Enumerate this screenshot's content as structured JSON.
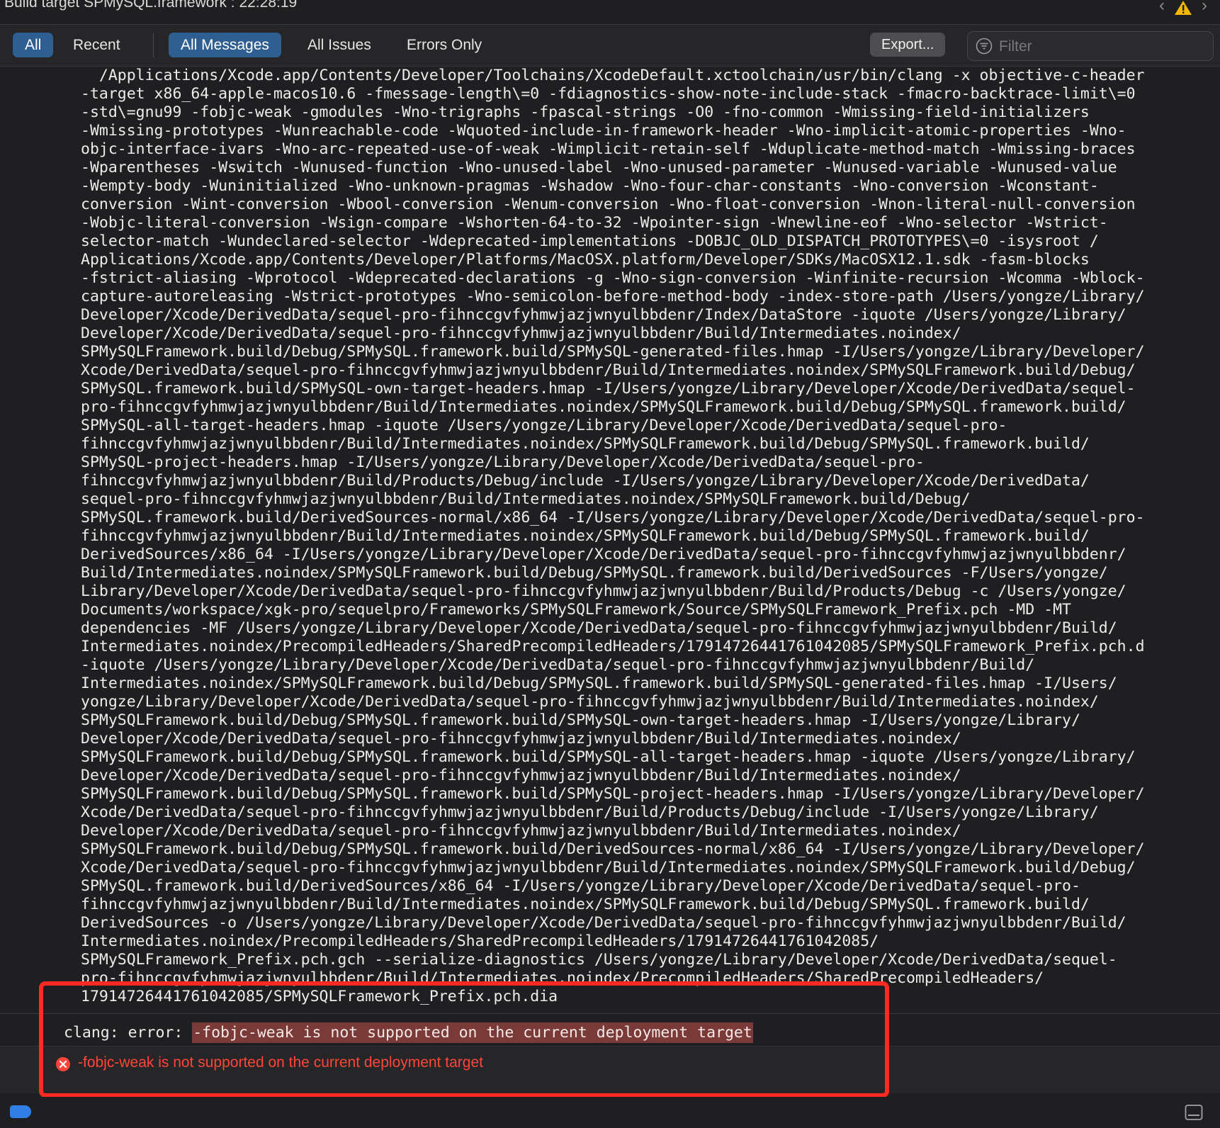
{
  "titlebar": {
    "title": "Build target SPMySQL.framework : 22:28:19"
  },
  "toolbar": {
    "scope_all": "All",
    "scope_recent": "Recent",
    "filter_all_messages": "All Messages",
    "filter_all_issues": "All Issues",
    "filter_errors_only": "Errors Only",
    "export_label": "Export...",
    "filter_placeholder": "Filter"
  },
  "log": {
    "lines": [
      "  /Applications/Xcode.app/Contents/Developer/Toolchains/XcodeDefault.xctoolchain/usr/bin/clang -x objective-c-header",
      "-target x86_64-apple-macos10.6 -fmessage-length\\=0 -fdiagnostics-show-note-include-stack -fmacro-backtrace-limit\\=0",
      "-std\\=gnu99 -fobjc-weak -gmodules -Wno-trigraphs -fpascal-strings -O0 -fno-common -Wmissing-field-initializers",
      "-Wmissing-prototypes -Wunreachable-code -Wquoted-include-in-framework-header -Wno-implicit-atomic-properties -Wno-",
      "objc-interface-ivars -Wno-arc-repeated-use-of-weak -Wimplicit-retain-self -Wduplicate-method-match -Wmissing-braces",
      "-Wparentheses -Wswitch -Wunused-function -Wno-unused-label -Wno-unused-parameter -Wunused-variable -Wunused-value",
      "-Wempty-body -Wuninitialized -Wno-unknown-pragmas -Wshadow -Wno-four-char-constants -Wno-conversion -Wconstant-",
      "conversion -Wint-conversion -Wbool-conversion -Wenum-conversion -Wno-float-conversion -Wnon-literal-null-conversion",
      "-Wobjc-literal-conversion -Wsign-compare -Wshorten-64-to-32 -Wpointer-sign -Wnewline-eof -Wno-selector -Wstrict-",
      "selector-match -Wundeclared-selector -Wdeprecated-implementations -DOBJC_OLD_DISPATCH_PROTOTYPES\\=0 -isysroot /",
      "Applications/Xcode.app/Contents/Developer/Platforms/MacOSX.platform/Developer/SDKs/MacOSX12.1.sdk -fasm-blocks",
      "-fstrict-aliasing -Wprotocol -Wdeprecated-declarations -g -Wno-sign-conversion -Winfinite-recursion -Wcomma -Wblock-",
      "capture-autoreleasing -Wstrict-prototypes -Wno-semicolon-before-method-body -index-store-path /Users/yongze/Library/",
      "Developer/Xcode/DerivedData/sequel-pro-fihnccgvfyhmwjazjwnyulbbdenr/Index/DataStore -iquote /Users/yongze/Library/",
      "Developer/Xcode/DerivedData/sequel-pro-fihnccgvfyhmwjazjwnyulbbdenr/Build/Intermediates.noindex/",
      "SPMySQLFramework.build/Debug/SPMySQL.framework.build/SPMySQL-generated-files.hmap -I/Users/yongze/Library/Developer/",
      "Xcode/DerivedData/sequel-pro-fihnccgvfyhmwjazjwnyulbbdenr/Build/Intermediates.noindex/SPMySQLFramework.build/Debug/",
      "SPMySQL.framework.build/SPMySQL-own-target-headers.hmap -I/Users/yongze/Library/Developer/Xcode/DerivedData/sequel-",
      "pro-fihnccgvfyhmwjazjwnyulbbdenr/Build/Intermediates.noindex/SPMySQLFramework.build/Debug/SPMySQL.framework.build/",
      "SPMySQL-all-target-headers.hmap -iquote /Users/yongze/Library/Developer/Xcode/DerivedData/sequel-pro-",
      "fihnccgvfyhmwjazjwnyulbbdenr/Build/Intermediates.noindex/SPMySQLFramework.build/Debug/SPMySQL.framework.build/",
      "SPMySQL-project-headers.hmap -I/Users/yongze/Library/Developer/Xcode/DerivedData/sequel-pro-",
      "fihnccgvfyhmwjazjwnyulbbdenr/Build/Products/Debug/include -I/Users/yongze/Library/Developer/Xcode/DerivedData/",
      "sequel-pro-fihnccgvfyhmwjazjwnyulbbdenr/Build/Intermediates.noindex/SPMySQLFramework.build/Debug/",
      "SPMySQL.framework.build/DerivedSources-normal/x86_64 -I/Users/yongze/Library/Developer/Xcode/DerivedData/sequel-pro-",
      "fihnccgvfyhmwjazjwnyulbbdenr/Build/Intermediates.noindex/SPMySQLFramework.build/Debug/SPMySQL.framework.build/",
      "DerivedSources/x86_64 -I/Users/yongze/Library/Developer/Xcode/DerivedData/sequel-pro-fihnccgvfyhmwjazjwnyulbbdenr/",
      "Build/Intermediates.noindex/SPMySQLFramework.build/Debug/SPMySQL.framework.build/DerivedSources -F/Users/yongze/",
      "Library/Developer/Xcode/DerivedData/sequel-pro-fihnccgvfyhmwjazjwnyulbbdenr/Build/Products/Debug -c /Users/yongze/",
      "Documents/workspace/xgk-pro/sequelpro/Frameworks/SPMySQLFramework/Source/SPMySQLFramework_Prefix.pch -MD -MT",
      "dependencies -MF /Users/yongze/Library/Developer/Xcode/DerivedData/sequel-pro-fihnccgvfyhmwjazjwnyulbbdenr/Build/",
      "Intermediates.noindex/PrecompiledHeaders/SharedPrecompiledHeaders/1791472644176104208​5/SPMySQLFramework_Prefix.pch.d",
      "-iquote /Users/yongze/Library/Developer/Xcode/DerivedData/sequel-pro-fihnccgvfyhmwjazjwnyulbbdenr/Build/",
      "Intermediates.noindex/SPMySQLFramework.build/Debug/SPMySQL.framework.build/SPMySQL-generated-files.hmap -I/Users/",
      "yongze/Library/Developer/Xcode/DerivedData/sequel-pro-fihnccgvfyhmwjazjwnyulbbdenr/Build/Intermediates.noindex/",
      "SPMySQLFramework.build/Debug/SPMySQL.framework.build/SPMySQL-own-target-headers.hmap -I/Users/yongze/Library/",
      "Developer/Xcode/DerivedData/sequel-pro-fihnccgvfyhmwjazjwnyulbbdenr/Build/Intermediates.noindex/",
      "SPMySQLFramework.build/Debug/SPMySQL.framework.build/SPMySQL-all-target-headers.hmap -iquote /Users/yongze/Library/",
      "Developer/Xcode/DerivedData/sequel-pro-fihnccgvfyhmwjazjwnyulbbdenr/Build/Intermediates.noindex/",
      "SPMySQLFramework.build/Debug/SPMySQL.framework.build/SPMySQL-project-headers.hmap -I/Users/yongze/Library/Developer/",
      "Xcode/DerivedData/sequel-pro-fihnccgvfyhmwjazjwnyulbbdenr/Build/Products/Debug/include -I/Users/yongze/Library/",
      "Developer/Xcode/DerivedData/sequel-pro-fihnccgvfyhmwjazjwnyulbbdenr/Build/Intermediates.noindex/",
      "SPMySQLFramework.build/Debug/SPMySQL.framework.build/DerivedSources-normal/x86_64 -I/Users/yongze/Library/Developer/",
      "Xcode/DerivedData/sequel-pro-fihnccgvfyhmwjazjwnyulbbdenr/Build/Intermediates.noindex/SPMySQLFramework.build/Debug/",
      "SPMySQL.framework.build/DerivedSources/x86_64 -I/Users/yongze/Library/Developer/Xcode/DerivedData/sequel-pro-",
      "fihnccgvfyhmwjazjwnyulbbdenr/Build/Intermediates.noindex/SPMySQLFramework.build/Debug/SPMySQL.framework.build/",
      "DerivedSources -o /Users/yongze/Library/Developer/Xcode/DerivedData/sequel-pro-fihnccgvfyhmwjazjwnyulbbdenr/Build/",
      "Intermediates.noindex/PrecompiledHeaders/SharedPrecompiledHeaders/17914726441761042085/",
      "SPMySQLFramework_Prefix.pch.gch --serialize-diagnostics /Users/yongze/Library/Developer/Xcode/DerivedData/sequel-",
      "pro-fihnccgvfyhmwjazjwnyulbbdenr/Build/Intermediates.noindex/PrecompiledHeaders/SharedPrecompiledHeaders/",
      "17914726441761042085/SPMySQLFramework_Prefix.pch.dia"
    ]
  },
  "cmd": {
    "prefix": "clang: error: ",
    "highlight": "-fobjc-weak is not supported on the current deployment target"
  },
  "error": {
    "message": "-fobjc-weak is not supported on the current deployment target"
  },
  "colors": {
    "accent": "#2f5f92",
    "error": "#ff453a",
    "annotation_box": "#ff2a22",
    "warning": "#f5b800"
  }
}
